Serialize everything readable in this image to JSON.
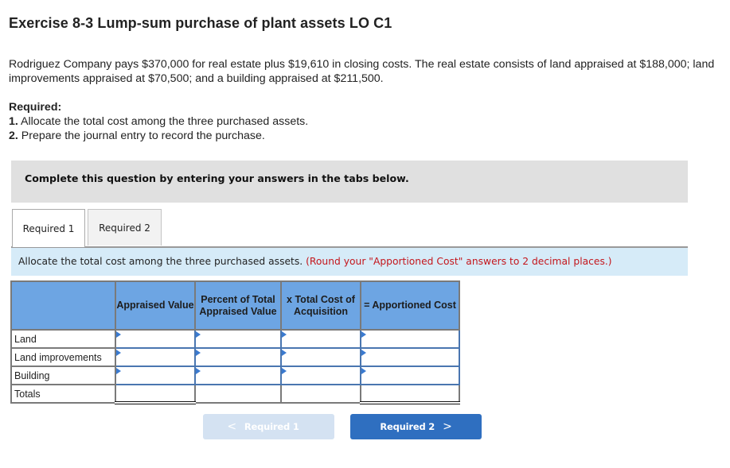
{
  "header": {
    "title": "Exercise 8-3 Lump-sum purchase of plant assets LO C1"
  },
  "problem": {
    "text": "Rodriguez Company pays $370,000 for real estate plus $19,610 in closing costs. The real estate consists of land appraised at $188,000; land improvements appraised at $70,500; and a building appraised at $211,500.",
    "required_heading": "Required:",
    "requirements": [
      {
        "num": "1.",
        "text": " Allocate the total cost among the three purchased assets."
      },
      {
        "num": "2.",
        "text": " Prepare the journal entry to record the purchase."
      }
    ]
  },
  "banner": {
    "text": "Complete this question by entering your answers in the tabs below."
  },
  "tabs": [
    {
      "label": "Required 1",
      "active": true
    },
    {
      "label": "Required 2",
      "active": false
    }
  ],
  "instructions": {
    "text": "Allocate the total cost among the three purchased assets. ",
    "note": "(Round your \"Apportioned Cost\" answers to 2 decimal places.)"
  },
  "table": {
    "headers": [
      "",
      "Appraised Value",
      "Percent of Total Appraised Value",
      "x Total Cost of Acquisition",
      "= Apportioned Cost"
    ],
    "rows": [
      {
        "label": "Land",
        "values": [
          "",
          "",
          "",
          ""
        ]
      },
      {
        "label": "Land improvements",
        "values": [
          "",
          "",
          "",
          ""
        ]
      },
      {
        "label": "Building",
        "values": [
          "",
          "",
          "",
          ""
        ]
      },
      {
        "label": "Totals",
        "values": [
          "",
          "",
          "",
          ""
        ]
      }
    ]
  },
  "navigation": {
    "prev_label": "Required 1",
    "next_label": "Required 2",
    "prev_icon": "chevron-left-icon",
    "next_icon": "chevron-right-icon",
    "prev_glyph": "<",
    "next_glyph": ">"
  },
  "colors": {
    "header_blue": "#6da5e3",
    "instruction_bg": "#d6ebf8",
    "note_red": "#c4161c",
    "next_button": "#2f6fc0",
    "prev_button_disabled": "#d4e2f2"
  }
}
